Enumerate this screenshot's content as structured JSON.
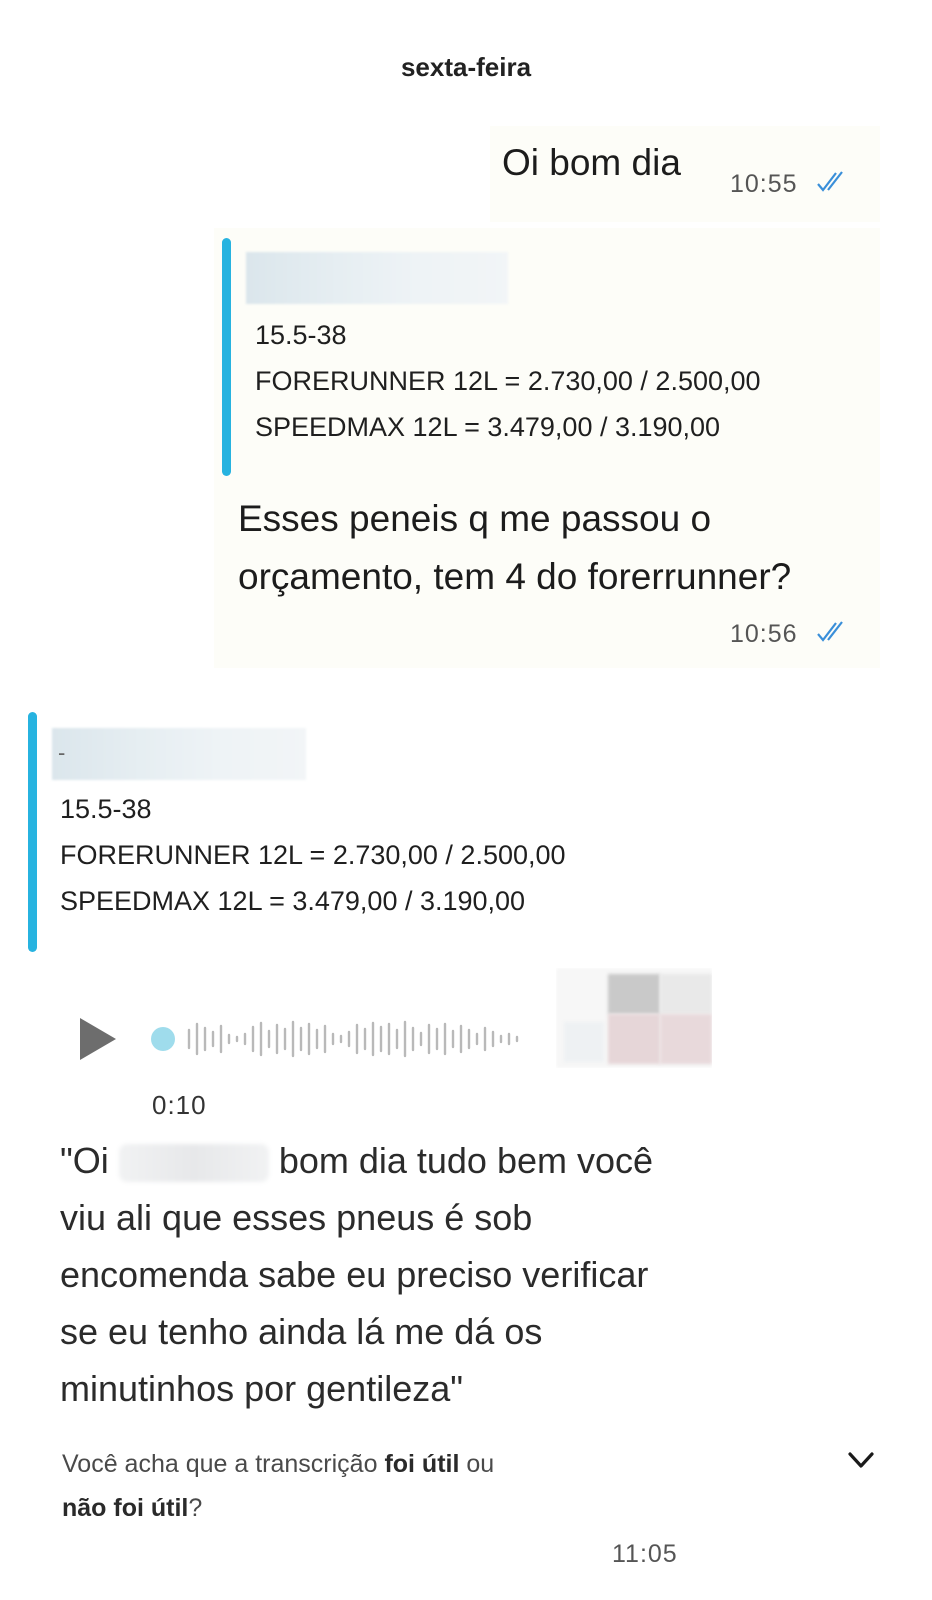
{
  "date_separator": "sexta-feira",
  "messages": {
    "first": {
      "text": "Oi bom dia",
      "time": "10:55"
    },
    "second": {
      "quote": {
        "line1": "15.5-38",
        "line2": "FORERUNNER 12L = 2.730,00 / 2.500,00",
        "line3": "SPEEDMAX 12L = 3.479,00 / 3.190,00"
      },
      "text_line1": "Esses peneis q me passou o",
      "text_line2": "orçamento, tem 4 do forerrunner?",
      "time": "10:56"
    },
    "incoming_quote": {
      "name_dash": "-",
      "line1": "15.5-38",
      "line2": "FORERUNNER 12L = 2.730,00 / 2.500,00",
      "line3": "SPEEDMAX 12L = 3.479,00 / 3.190,00"
    },
    "voice": {
      "duration": "0:10",
      "transcript_start": "\"Oi",
      "transcript_rest": "bom dia tudo bem você viu ali que esses pneus é sob encomenda sabe eu preciso verificar se eu tenho ainda lá me dá os minutinhos por gentileza\"",
      "feedback_prefix": "Você acha que a transcrição",
      "feedback_yes": "foi útil",
      "feedback_or": "ou",
      "feedback_no": "não foi útil",
      "feedback_suffix": "?",
      "time": "11:05"
    }
  },
  "colors": {
    "quote_bar": "#27b3e0",
    "read_ticks": "#3a8fd9",
    "play_button": "#6d6d6d",
    "voice_progress_dot": "#9fdcec"
  },
  "icons": {
    "read_receipt": "double-check-icon",
    "play": "play-icon",
    "expand": "chevron-down-icon"
  }
}
